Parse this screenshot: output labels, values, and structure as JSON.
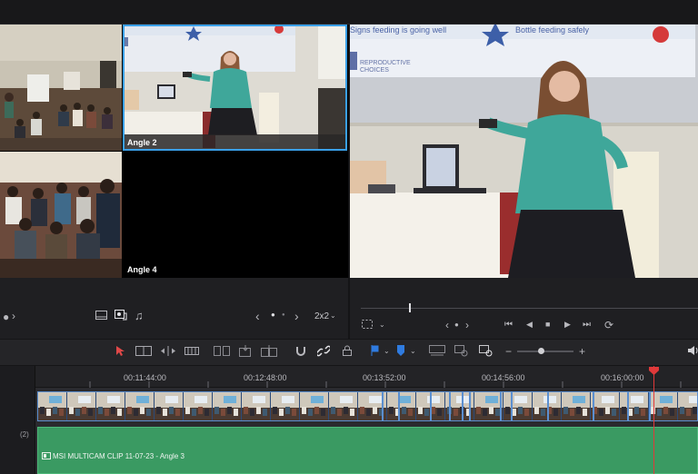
{
  "multicam": {
    "angles": [
      {
        "label": ""
      },
      {
        "label": "Angle 2"
      },
      {
        "label": ""
      },
      {
        "label": "Angle 4"
      }
    ],
    "selected": "Angle 2"
  },
  "program_viewer": {
    "slide_text_left": "Signs feeding is going well",
    "slide_text_right": "Bottle feeding safely",
    "slide_logo_line1": "REPRODUCTIVE",
    "slide_logo_line2": "CHOICES"
  },
  "multicam_controls": {
    "grid_label": "2x2"
  },
  "timeline": {
    "timecodes": [
      "00:11:44:00",
      "00:12:48:00",
      "00:13:52:00",
      "00:14:56:00",
      "00:16:00:00"
    ],
    "audio_track_number": "(2)",
    "audio_clip_label": "MSI MULTICAM CLIP 11-07-23 - Angle 3"
  },
  "colors": {
    "selection": "#3aa0e8",
    "playhead": "#e0393a",
    "audio_clip": "#3a9a62",
    "video_clip": "#2b4a78",
    "pointer_tool": "#e04848",
    "flag": "#2f7be0"
  },
  "icons": {
    "left_controls": [
      "viewer-icon",
      "clip-icon",
      "audio-icon",
      "chevron-left-icon",
      "page-dots",
      "chevron-right-icon",
      "chevron-down-icon"
    ],
    "right_controls": [
      "safe-area-icon",
      "jog-icon",
      "go-to-start-icon",
      "previous-frame-icon",
      "stop-icon",
      "play-icon",
      "go-to-end-icon",
      "loop-icon"
    ],
    "toolbar": [
      "pointer-icon",
      "trim-icon",
      "dynamic-trim-icon",
      "blade-icon",
      "insert-icon",
      "overwrite-icon",
      "replace-icon",
      "snapping-icon",
      "linked-selection-icon",
      "lock-icon",
      "flag-icon",
      "marker-icon",
      "zoom-full-icon",
      "zoom-detail-icon",
      "zoom-custom-icon",
      "zoom-out-icon",
      "zoom-in-icon",
      "volume-icon"
    ]
  }
}
